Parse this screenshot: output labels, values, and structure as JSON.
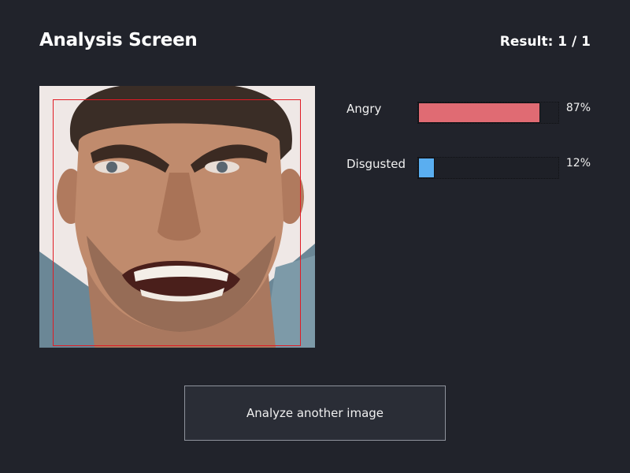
{
  "header": {
    "title": "Analysis Screen",
    "result": "Result: 1 / 1"
  },
  "image": {
    "alt": "Analyzed face",
    "face_box_color": "#e01b24"
  },
  "emotions": [
    {
      "label": "Angry",
      "percent_label": "87%",
      "value": 0.87,
      "color": "#e06b73"
    },
    {
      "label": "Disgusted",
      "percent_label": "12%",
      "value": 0.12,
      "color": "#5aaef0"
    }
  ],
  "actions": {
    "analyze_another_label": "Analyze another image"
  }
}
